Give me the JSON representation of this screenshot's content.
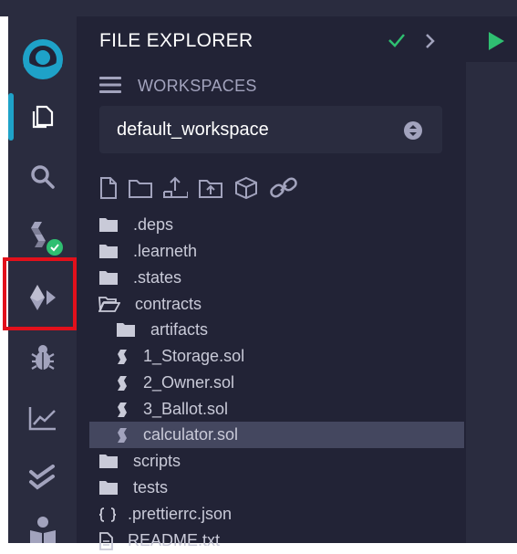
{
  "explorer": {
    "title": "FILE EXPLORER",
    "workspaces_label": "WORKSPACES",
    "workspace_selected": "default_workspace",
    "tree": [
      {
        "name": ".deps",
        "type": "folder"
      },
      {
        "name": ".learneth",
        "type": "folder"
      },
      {
        "name": ".states",
        "type": "folder"
      },
      {
        "name": "contracts",
        "type": "folder-open"
      },
      {
        "name": "artifacts",
        "type": "folder"
      },
      {
        "name": "1_Storage.sol",
        "type": "solidity"
      },
      {
        "name": "2_Owner.sol",
        "type": "solidity"
      },
      {
        "name": "3_Ballot.sol",
        "type": "solidity"
      },
      {
        "name": "calculator.sol",
        "type": "solidity",
        "selected": true
      },
      {
        "name": "scripts",
        "type": "folder"
      },
      {
        "name": "tests",
        "type": "folder"
      },
      {
        "name": ".prettierrc.json",
        "type": "json"
      },
      {
        "name": "README.txt",
        "type": "text"
      }
    ]
  },
  "sidebar_icons": [
    "remix-logo-icon",
    "file-explorer-icon",
    "search-icon",
    "solidity-compiler-icon",
    "deploy-run-icon",
    "debugger-icon",
    "analysis-icon",
    "unit-testing-icon",
    "learneth-icon"
  ],
  "toolbar_icons": [
    "new-file-icon",
    "new-folder-icon",
    "publish-gist-icon",
    "upload-icon",
    "import-package-icon",
    "link-icon"
  ],
  "colors": {
    "panel": "#222336",
    "sidebar": "#2a2c3f",
    "accent_blue": "#1ea2c8",
    "success_green": "#2fbf71",
    "highlight_red": "#e2101b",
    "selected_row": "#44475f"
  }
}
